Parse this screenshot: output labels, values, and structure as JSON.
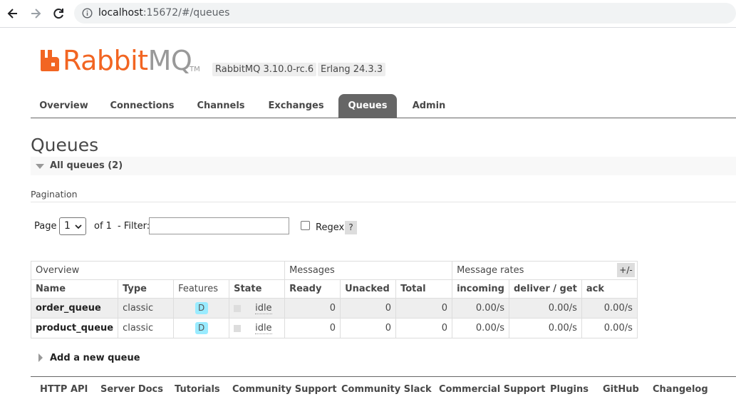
{
  "browser": {
    "url_host": "localhost",
    "url_rest": ":15672/#/queues"
  },
  "header": {
    "logo_rabbit": "Rabbit",
    "logo_mq": "MQ",
    "logo_tm": "TM",
    "version": "RabbitMQ 3.10.0-rc.6",
    "erlang": "Erlang 24.3.3"
  },
  "tabs": [
    {
      "label": "Overview"
    },
    {
      "label": "Connections"
    },
    {
      "label": "Channels"
    },
    {
      "label": "Exchanges"
    },
    {
      "label": "Queues",
      "active": true
    },
    {
      "label": "Admin"
    }
  ],
  "page": {
    "title": "Queues",
    "section_label": "All queues (2)",
    "pagination_label": "Pagination",
    "page_label": "Page",
    "page_value": "1",
    "of_label": "of 1",
    "filter_label": "- Filter:",
    "regex_label": "Regex",
    "help_label": "?",
    "plus_minus": "+/-",
    "add_queue": "Add a new queue"
  },
  "table": {
    "groups": [
      "Overview",
      "Messages",
      "Message rates"
    ],
    "columns": [
      "Name",
      "Type",
      "Features",
      "State",
      "Ready",
      "Unacked",
      "Total",
      "incoming",
      "deliver / get",
      "ack"
    ],
    "rows": [
      {
        "name": "order_queue",
        "type": "classic",
        "feature": "D",
        "state": "idle",
        "ready": "0",
        "unacked": "0",
        "total": "0",
        "incoming": "0.00/s",
        "deliver_get": "0.00/s",
        "ack": "0.00/s"
      },
      {
        "name": "product_queue",
        "type": "classic",
        "feature": "D",
        "state": "idle",
        "ready": "0",
        "unacked": "0",
        "total": "0",
        "incoming": "0.00/s",
        "deliver_get": "0.00/s",
        "ack": "0.00/s"
      }
    ]
  },
  "footer": [
    "HTTP API",
    "Server Docs",
    "Tutorials",
    "Community Support",
    "Community Slack",
    "Commercial Support",
    "Plugins",
    "GitHub",
    "Changelog"
  ],
  "colors": {
    "brand_orange": "#f26522",
    "tab_active": "#666666",
    "feature_badge": "#99ebff"
  }
}
